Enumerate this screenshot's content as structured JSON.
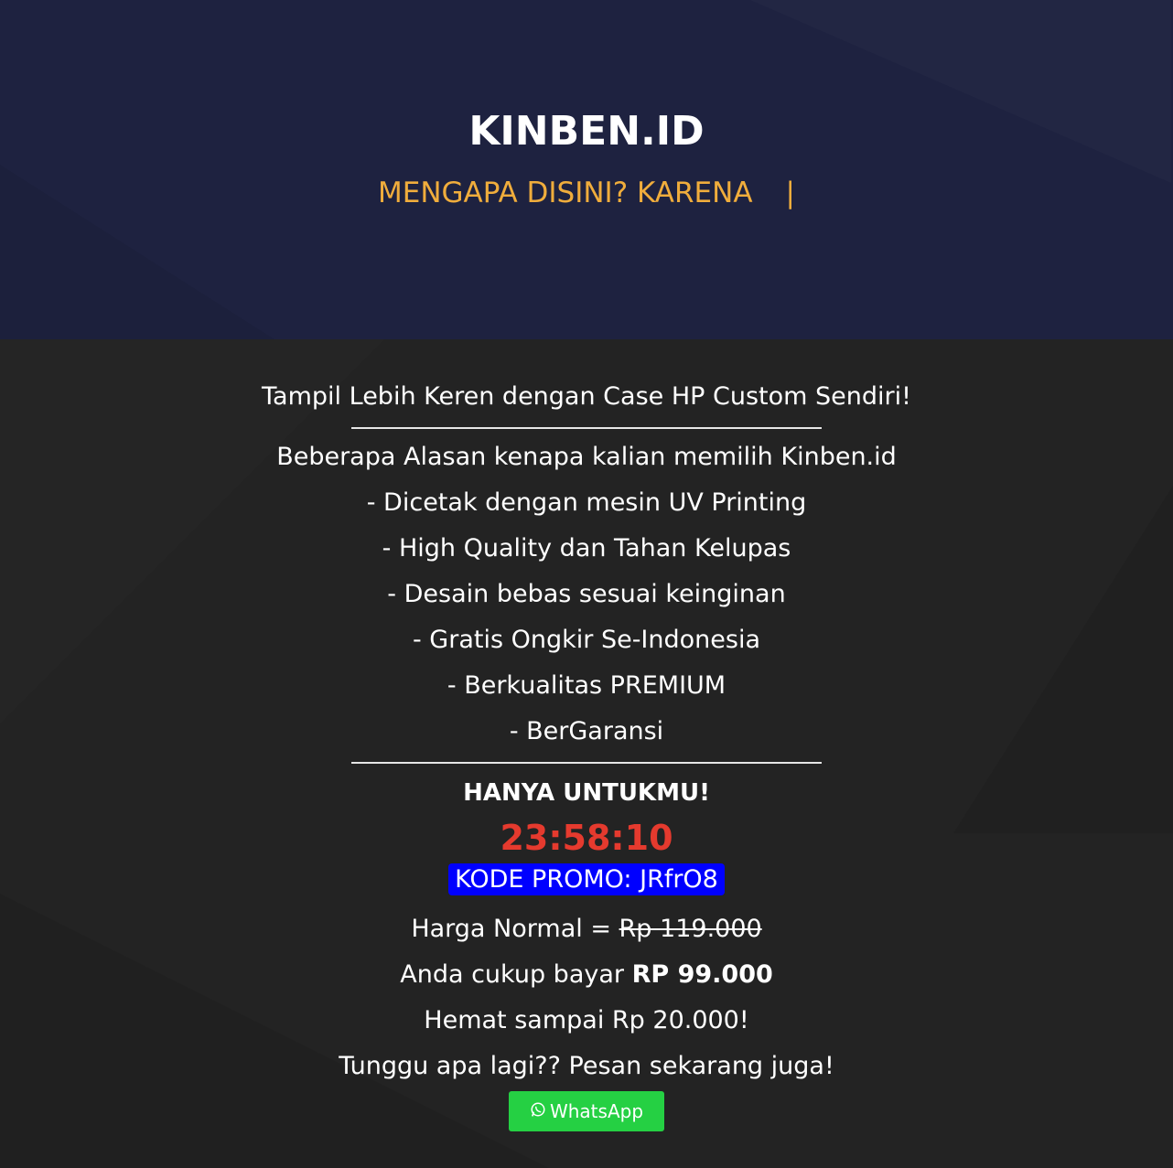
{
  "hero": {
    "brand": "KINBEN.ID",
    "tagline": "MENGAPA DISINI? KARENA",
    "cursor": "|"
  },
  "content": {
    "heading": "Tampil Lebih Keren dengan Case HP Custom Sendiri!",
    "reasons_title": "Beberapa Alasan kenapa kalian memilih Kinben.id",
    "reasons": [
      "- Dicetak dengan mesin UV Printing",
      "- High Quality dan Tahan Kelupas",
      "- Desain bebas sesuai keinginan",
      "- Gratis Ongkir Se-Indonesia",
      "- Berkualitas PREMIUM",
      "- BerGaransi"
    ],
    "offer_title": "HANYA UNTUKMU!",
    "countdown": "23:58:10",
    "promo_code": "KODE PROMO: JRfrO8",
    "normal_price_label": "Harga Normal =",
    "normal_price": "Rp 119.000",
    "pay_label": "Anda cukup bayar",
    "pay_price": "RP 99.000",
    "savings": "Hemat sampai Rp 20.000!",
    "cta_text": "Tunggu apa lagi?? Pesan sekarang juga!",
    "whatsapp_label": "WhatsApp"
  },
  "colors": {
    "hero_bg": "#1e2240",
    "body_bg": "#232323",
    "tagline": "#f0ad3c",
    "timer": "#e53a2e",
    "promo_bg": "#0000ff",
    "whatsapp_bg": "#25d043"
  },
  "icons": {
    "whatsapp": "whatsapp-icon"
  }
}
